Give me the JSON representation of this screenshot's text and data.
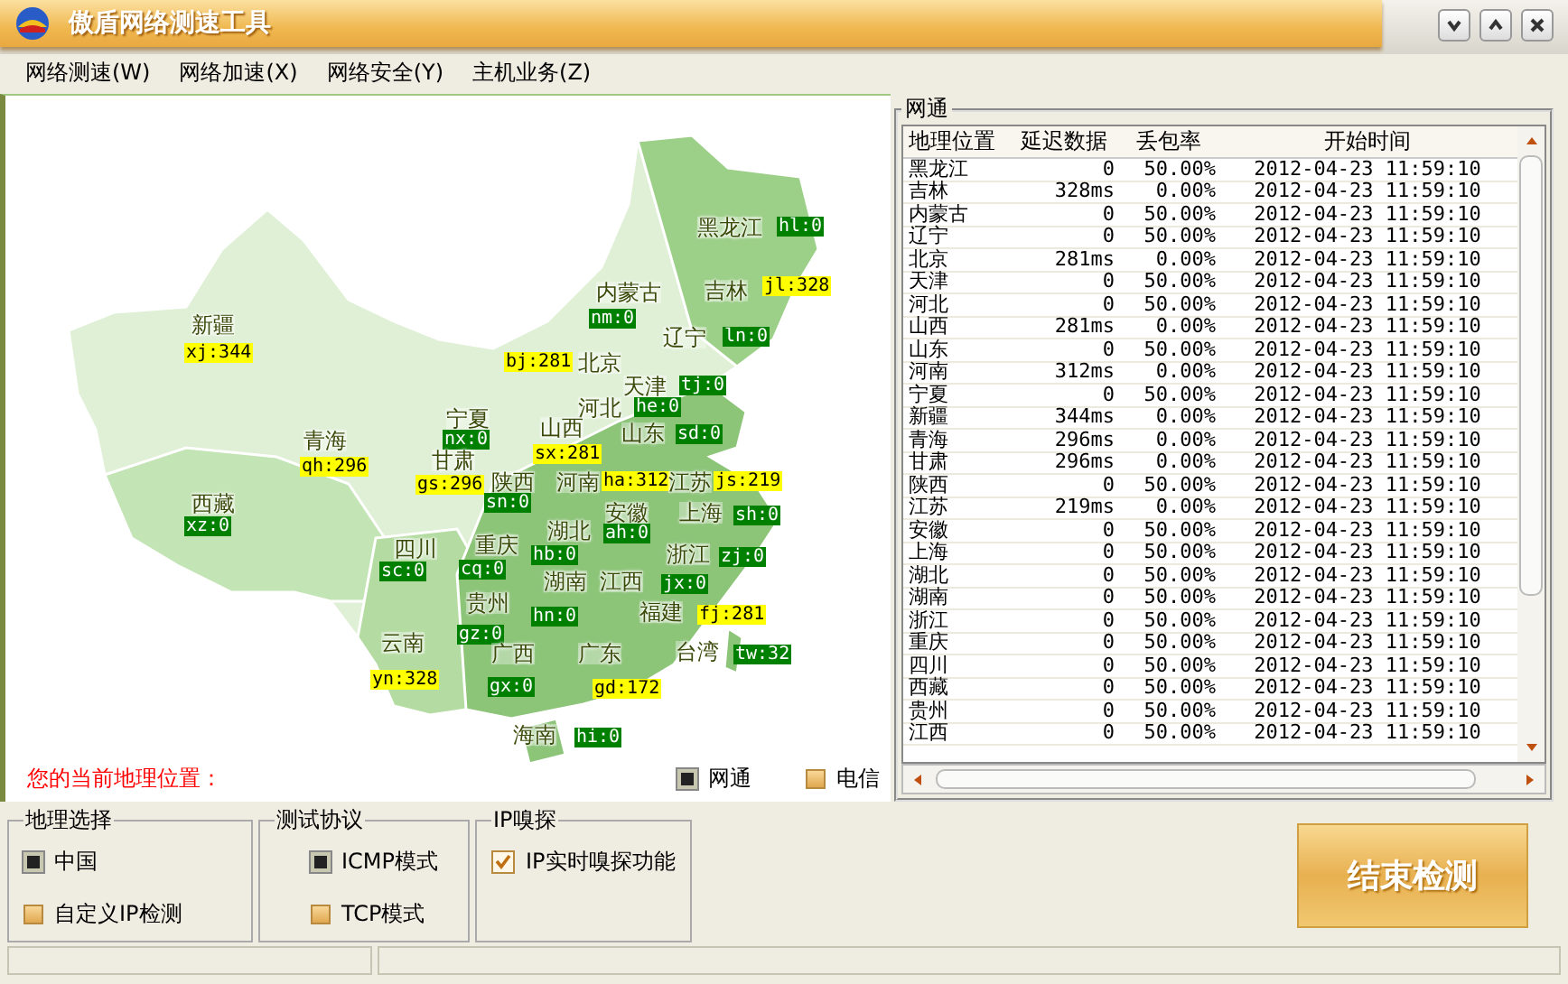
{
  "window": {
    "title": "傲盾网络测速工具"
  },
  "menu": [
    "网络测速(W)",
    "网络加速(X)",
    "网络安全(Y)",
    "主机业务(Z)"
  ],
  "map": {
    "provinces": [
      {
        "name": "黑龙江",
        "tag": "hl:0",
        "color": "#008000"
      },
      {
        "name": "内蒙古",
        "tag": "nm:0",
        "color": "#008000"
      },
      {
        "name": "吉林",
        "tag": "jl:328",
        "color": "#ffff00"
      },
      {
        "name": "新疆",
        "tag": "xj:344",
        "color": "#ffff00"
      },
      {
        "name": "辽宁",
        "tag": "ln:0",
        "color": "#008000"
      },
      {
        "name": "北京",
        "tag": "bj:281",
        "color": "#ffff00"
      },
      {
        "name": "天津",
        "tag": "tj:0",
        "color": "#008000"
      },
      {
        "name": "河北",
        "tag": "he:0",
        "color": "#008000"
      },
      {
        "name": "青海",
        "tag": "qh:296",
        "color": "#ffff00"
      },
      {
        "name": "宁夏",
        "tag": "nx:0",
        "color": "#008000"
      },
      {
        "name": "山西",
        "tag": "sx:281",
        "color": "#ffff00"
      },
      {
        "name": "山东",
        "tag": "sd:0",
        "color": "#008000"
      },
      {
        "name": "甘肃",
        "tag": "gs:296",
        "color": "#ffff00"
      },
      {
        "name": "陕西",
        "tag": "sn:0",
        "color": "#008000"
      },
      {
        "name": "河南",
        "tag": "ha:312",
        "color": "#ffff00"
      },
      {
        "name": "江苏",
        "tag": "js:219",
        "color": "#ffff00"
      },
      {
        "name": "西藏",
        "tag": "xz:0",
        "color": "#008000"
      },
      {
        "name": "安徽",
        "tag": "ah:0",
        "color": "#008000"
      },
      {
        "name": "上海",
        "tag": "sh:0",
        "color": "#008000"
      },
      {
        "name": "四川",
        "tag": "sc:0",
        "color": "#008000"
      },
      {
        "name": "重庆",
        "tag": "cq:0",
        "color": "#008000"
      },
      {
        "name": "湖北",
        "tag": "hb:0",
        "color": "#008000"
      },
      {
        "name": "浙江",
        "tag": "zj:0",
        "color": "#008000"
      },
      {
        "name": "湖南",
        "tag": "hn:0",
        "color": "#008000"
      },
      {
        "name": "江西",
        "tag": "jx:0",
        "color": "#008000"
      },
      {
        "name": "贵州",
        "tag": "gz:0",
        "color": "#008000"
      },
      {
        "name": "福建",
        "tag": "fj:281",
        "color": "#ffff00"
      },
      {
        "name": "云南",
        "tag": "yn:328",
        "color": "#ffff00"
      },
      {
        "name": "广西",
        "tag": "gx:0",
        "color": "#008000"
      },
      {
        "name": "广东",
        "tag": "gd:172",
        "color": "#ffff00"
      },
      {
        "name": "台湾",
        "tag": "tw:32",
        "color": "#008000"
      },
      {
        "name": "海南",
        "tag": "hi:0",
        "color": "#008000"
      }
    ],
    "location_label": "您的当前地理位置：",
    "legend": [
      {
        "label": "网通",
        "selected": true
      },
      {
        "label": "电信",
        "selected": false
      }
    ]
  },
  "isp_panel": {
    "title": "网通",
    "table": {
      "columns": [
        "地理位置",
        "延迟数据",
        "丢包率",
        "开始时间"
      ],
      "rows": [
        [
          "黑龙江",
          "0",
          "50.00%",
          "2012-04-23 11:59:10"
        ],
        [
          "吉林",
          "328ms",
          "0.00%",
          "2012-04-23 11:59:10"
        ],
        [
          "内蒙古",
          "0",
          "50.00%",
          "2012-04-23 11:59:10"
        ],
        [
          "辽宁",
          "0",
          "50.00%",
          "2012-04-23 11:59:10"
        ],
        [
          "北京",
          "281ms",
          "0.00%",
          "2012-04-23 11:59:10"
        ],
        [
          "天津",
          "0",
          "50.00%",
          "2012-04-23 11:59:10"
        ],
        [
          "河北",
          "0",
          "50.00%",
          "2012-04-23 11:59:10"
        ],
        [
          "山西",
          "281ms",
          "0.00%",
          "2012-04-23 11:59:10"
        ],
        [
          "山东",
          "0",
          "50.00%",
          "2012-04-23 11:59:10"
        ],
        [
          "河南",
          "312ms",
          "0.00%",
          "2012-04-23 11:59:10"
        ],
        [
          "宁夏",
          "0",
          "50.00%",
          "2012-04-23 11:59:10"
        ],
        [
          "新疆",
          "344ms",
          "0.00%",
          "2012-04-23 11:59:10"
        ],
        [
          "青海",
          "296ms",
          "0.00%",
          "2012-04-23 11:59:10"
        ],
        [
          "甘肃",
          "296ms",
          "0.00%",
          "2012-04-23 11:59:10"
        ],
        [
          "陕西",
          "0",
          "50.00%",
          "2012-04-23 11:59:10"
        ],
        [
          "江苏",
          "219ms",
          "0.00%",
          "2012-04-23 11:59:10"
        ],
        [
          "安徽",
          "0",
          "50.00%",
          "2012-04-23 11:59:10"
        ],
        [
          "上海",
          "0",
          "50.00%",
          "2012-04-23 11:59:10"
        ],
        [
          "湖北",
          "0",
          "50.00%",
          "2012-04-23 11:59:10"
        ],
        [
          "湖南",
          "0",
          "50.00%",
          "2012-04-23 11:59:10"
        ],
        [
          "浙江",
          "0",
          "50.00%",
          "2012-04-23 11:59:10"
        ],
        [
          "重庆",
          "0",
          "50.00%",
          "2012-04-23 11:59:10"
        ],
        [
          "四川",
          "0",
          "50.00%",
          "2012-04-23 11:59:10"
        ],
        [
          "西藏",
          "0",
          "50.00%",
          "2012-04-23 11:59:10"
        ],
        [
          "贵州",
          "0",
          "50.00%",
          "2012-04-23 11:59:10"
        ],
        [
          "江西",
          "0",
          "50.00%",
          "2012-04-23 11:59:10"
        ]
      ]
    }
  },
  "region_group": {
    "title": "地理选择",
    "options": [
      {
        "label": "中国",
        "selected": true
      },
      {
        "label": "自定义IP检测",
        "selected": false
      }
    ]
  },
  "protocol_group": {
    "title": "测试协议",
    "options": [
      {
        "label": "ICMP模式",
        "selected": true
      },
      {
        "label": "TCP模式",
        "selected": false
      }
    ]
  },
  "sniff_group": {
    "title": "IP嗅探",
    "option": {
      "label": "IP实时嗅探功能",
      "checked": true
    }
  },
  "stop_button": "结束检测"
}
